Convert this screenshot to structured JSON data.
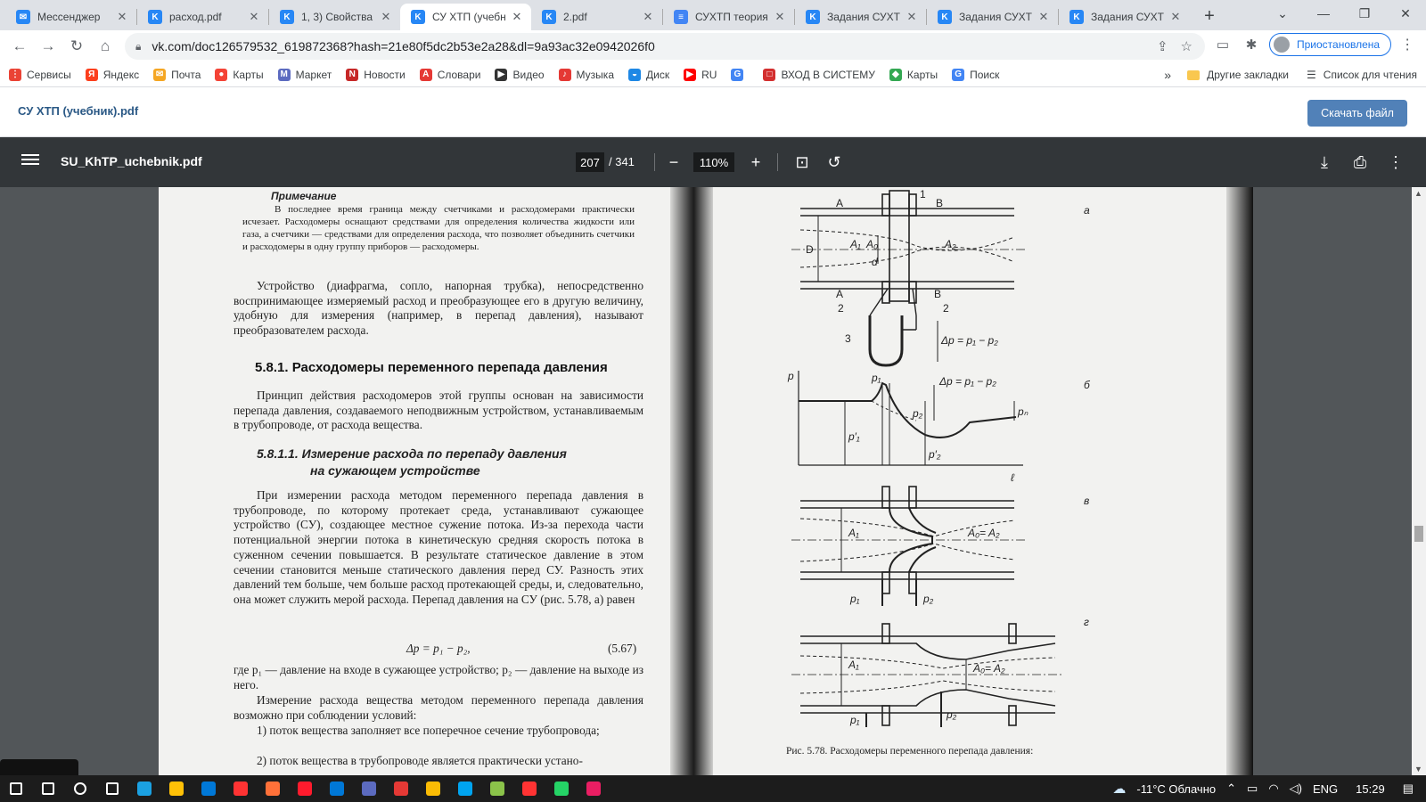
{
  "tabs": [
    {
      "title": "Мессенджер",
      "icon": "messenger-icon",
      "color": "#2787f5",
      "glyph": "✉",
      "active": false
    },
    {
      "title": "расход.pdf",
      "icon": "vk-icon",
      "color": "#2787f5",
      "glyph": "K",
      "active": false
    },
    {
      "title": "1, 3) Свойства",
      "icon": "vk-icon",
      "color": "#2787f5",
      "glyph": "K",
      "active": false
    },
    {
      "title": "СУ ХТП (учебн",
      "icon": "vk-icon",
      "color": "#2787f5",
      "glyph": "K",
      "active": true
    },
    {
      "title": "2.pdf",
      "icon": "vk-icon",
      "color": "#2787f5",
      "glyph": "K",
      "active": false
    },
    {
      "title": "СУХТП теория",
      "icon": "docs-icon",
      "color": "#4285f4",
      "glyph": "≡",
      "active": false
    },
    {
      "title": "Задания СУХТ",
      "icon": "vk-icon",
      "color": "#2787f5",
      "glyph": "K",
      "active": false
    },
    {
      "title": "Задания СУХТ",
      "icon": "vk-icon",
      "color": "#2787f5",
      "glyph": "K",
      "active": false
    },
    {
      "title": "Задания СУХТ",
      "icon": "vk-icon",
      "color": "#2787f5",
      "glyph": "K",
      "active": false
    }
  ],
  "url": "vk.com/doc126579532_619872368?hash=21e80f5dc2b53e2a28&dl=9a93ac32e0942026f0",
  "profile_label": "Приостановлена",
  "bookmarks": [
    {
      "label": "Сервисы",
      "icon": "apps-icon",
      "color": "#ea4335",
      "glyph": "⋮"
    },
    {
      "label": "Яндекс",
      "icon": "yandex-icon",
      "color": "#fc3f1d",
      "glyph": "Я"
    },
    {
      "label": "Почта",
      "icon": "mail-icon",
      "color": "#f5a623",
      "glyph": "✉"
    },
    {
      "label": "Карты",
      "icon": "maps-pin-icon",
      "color": "#f44336",
      "glyph": "●"
    },
    {
      "label": "Маркет",
      "icon": "market-icon",
      "color": "#5c6bc0",
      "glyph": "M"
    },
    {
      "label": "Новости",
      "icon": "news-icon",
      "color": "#c62828",
      "glyph": "N"
    },
    {
      "label": "Словари",
      "icon": "dictionary-icon",
      "color": "#e53935",
      "glyph": "A"
    },
    {
      "label": "Видео",
      "icon": "video-icon",
      "color": "#333333",
      "glyph": "▶"
    },
    {
      "label": "Музыка",
      "icon": "music-icon",
      "color": "#e53935",
      "glyph": "♪"
    },
    {
      "label": "Диск",
      "icon": "disk-icon",
      "color": "#1e88e5",
      "glyph": "◒"
    },
    {
      "label": "RU",
      "icon": "youtube-icon",
      "color": "#ff0000",
      "glyph": "▶"
    },
    {
      "label": "",
      "icon": "google-icon",
      "color": "#4285f4",
      "glyph": "G"
    },
    {
      "label": "ВХОД В СИСТЕМУ",
      "icon": "login-icon",
      "color": "#d32f2f",
      "glyph": "□"
    },
    {
      "label": "Карты",
      "icon": "maps-icon",
      "color": "#34a853",
      "glyph": "◆"
    },
    {
      "label": "Поиск",
      "icon": "google-search-icon",
      "color": "#4285f4",
      "glyph": "G"
    }
  ],
  "bookmarks_more": "»",
  "other_bookmarks": "Другие закладки",
  "reading_list": "Список для чтения",
  "vk": {
    "filename": "СУ ХТП (учебник).pdf",
    "download_label": "Скачать файл"
  },
  "pdf": {
    "title": "SU_KhTP_uchebnik.pdf",
    "page": "207",
    "total": "/ 341",
    "zoom": "110%"
  },
  "doc": {
    "note_heading": "Примечание",
    "note_text": "В последнее время граница между счетчиками и расходомерами практически исчезает. Расходомеры оснащают средствами для определения количества жидкости или газа, а счетчики — средствами для определения расхода, что позволяет объединить счетчики и расходомеры в одну группу приборов — расходомеры.",
    "p1": "Устройство (диафрагма, сопло, напорная трубка), непосредственно воспринимающее измеряемый расход и преобразующее его в другую величину, удобную для измерения (например, в перепад давления), называют преобразователем расхода.",
    "h1": "5.8.1. Расходомеры переменного перепада давления",
    "p2": "Принцип действия расходомеров этой группы основан на зависимости перепада давления, создаваемого неподвижным устройством, устанавливаемым в трубопроводе, от расхода вещества.",
    "h2_line1": "5.8.1.1. Измерение расхода по перепаду давления",
    "h2_line2": "на сужающем устройстве",
    "p3": "При измерении расхода методом переменного перепада давления в трубопроводе, по которому протекает среда, устанавливают сужающее устройство (СУ), создающее местное сужение потока. Из-за перехода части потенциальной энергии потока в кинетическую средняя скорость потока в суженном сечении повышается. В результате статическое давление в этом сечении становится меньше статического давления перед СУ. Разность этих давлений тем больше, чем больше расход протекающей среды, и, следовательно, она может служить мерой расхода. Перепад давления на СУ (рис. 5.78, а) равен",
    "eq": "Δp = p₁ − p₂,",
    "eq_num": "(5.67)",
    "p4": "где p₁ — давление на входе в сужающее устройство; p₂ — давление на выходе из него.",
    "p5": "Измерение расхода вещества методом переменного перепада давления возможно при соблюдении условий:",
    "li1": "1) поток вещества заполняет все поперечное сечение трубопровода;",
    "li2": "2) поток вещества в трубопроводе является практически устано-",
    "fig_caption": "Рис. 5.78. Расходомеры переменного перепада давления:",
    "fig_labels": {
      "a": "а",
      "b": "б",
      "v": "в",
      "g": "г",
      "A": "A",
      "B": "B",
      "D": "D",
      "d": "d",
      "A1": "A₁",
      "A0": "A₀",
      "A2": "A₂",
      "n1": "1",
      "n2": "2",
      "n2b": "2",
      "n3": "3",
      "dp": "Δp = p₁ − p₂",
      "dp2": "Δp = p₁ − p₂",
      "p": "p",
      "l": "ℓ",
      "p1": "p₁",
      "p2": "p₂",
      "pn": "pₙ",
      "p1p": "p′₁",
      "p2p": "p′₂",
      "A0A2": "A₀= A₂",
      "v_p1": "p₁",
      "v_p2": "p₂",
      "g_A1": "A₁",
      "g_A0A2": "A₀= A₂",
      "g_p1": "p₁",
      "g_p2": "p₂",
      "v_A1": "A₁"
    }
  },
  "taskbar": {
    "weather": "-11°C Облачно",
    "lang": "ENG",
    "time": "15:29",
    "apps": [
      {
        "icon": "windows-start-icon",
        "color": "#ffffff"
      },
      {
        "icon": "search-icon",
        "color": "#ffffff"
      },
      {
        "icon": "cortana-icon",
        "color": "#ffffff"
      },
      {
        "icon": "task-view-icon",
        "color": "#ffffff"
      },
      {
        "icon": "edge-icon",
        "color": "#1ba1e2"
      },
      {
        "icon": "file-explorer-icon",
        "color": "#ffc107"
      },
      {
        "icon": "store-icon",
        "color": "#0078d7"
      },
      {
        "icon": "yandex-browser-icon",
        "color": "#ff3333"
      },
      {
        "icon": "firefox-icon",
        "color": "#ff7139"
      },
      {
        "icon": "opera-icon",
        "color": "#ff1b2d"
      },
      {
        "icon": "mail-app-icon",
        "color": "#0078d7"
      },
      {
        "icon": "save-icon",
        "color": "#5c6bc0"
      },
      {
        "icon": "app-red-icon",
        "color": "#e53935"
      },
      {
        "icon": "chrome-icon",
        "color": "#fbbc05"
      },
      {
        "icon": "app-grid-icon",
        "color": "#00a4ef"
      },
      {
        "icon": "app-doc-icon",
        "color": "#8bc34a"
      },
      {
        "icon": "yandex-app-icon",
        "color": "#ff3333"
      },
      {
        "icon": "whatsapp-icon",
        "color": "#25d366"
      },
      {
        "icon": "app-chat-icon",
        "color": "#e91e63"
      }
    ]
  }
}
